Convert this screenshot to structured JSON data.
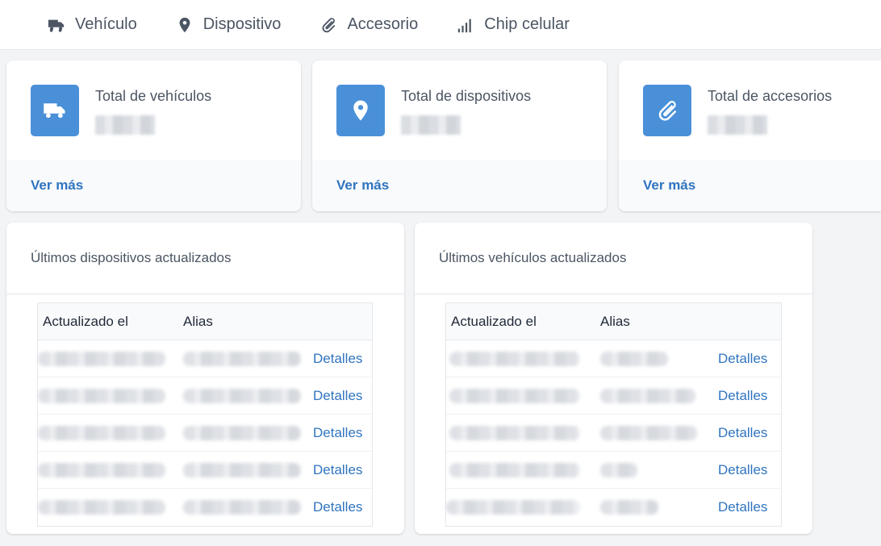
{
  "nav": {
    "items": [
      {
        "label": "Vehículo",
        "icon": "truck-icon"
      },
      {
        "label": "Dispositivo",
        "icon": "map-pin-icon"
      },
      {
        "label": "Accesorio",
        "icon": "paperclip-icon"
      },
      {
        "label": "Chip celular",
        "icon": "signal-icon"
      }
    ]
  },
  "stats": [
    {
      "title": "Total de vehículos",
      "icon": "truck-icon",
      "link": "Ver más"
    },
    {
      "title": "Total de dispositivos",
      "icon": "map-pin-icon",
      "link": "Ver más"
    },
    {
      "title": "Total de accesorios",
      "icon": "paperclip-icon",
      "link": "Ver más"
    }
  ],
  "devices": {
    "title": "Últimos dispositivos actualizados",
    "columns": [
      "Actualizado el",
      "Alias"
    ],
    "rows": [
      {
        "action": "Detalles"
      },
      {
        "action": "Detalles"
      },
      {
        "action": "Detalles"
      },
      {
        "action": "Detalles"
      },
      {
        "action": "Detalles"
      }
    ]
  },
  "vehicles": {
    "title": "Últimos vehículos actualizados",
    "columns": [
      "Actualizado el",
      "Alias"
    ],
    "rows": [
      {
        "action": "Detalles"
      },
      {
        "action": "Detalles"
      },
      {
        "action": "Detalles"
      },
      {
        "action": "Detalles"
      },
      {
        "action": "Detalles"
      }
    ]
  },
  "colors": {
    "accent": "#4a90d9",
    "link": "#2f74c0"
  }
}
